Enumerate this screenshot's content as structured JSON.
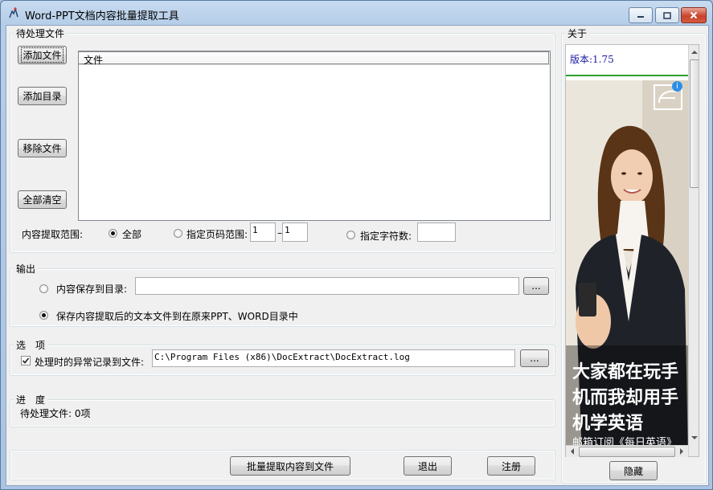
{
  "window": {
    "title": "Word-PPT文档内容批量提取工具"
  },
  "files_group": {
    "legend": "待处理文件",
    "buttons": {
      "add_file": "添加文件",
      "add_dir": "添加目录",
      "remove_file": "移除文件",
      "clear_all": "全部清空"
    },
    "list_header": "文件",
    "range_label": "内容提取范围:",
    "radio_all": "全部",
    "radio_pages": "指定页码范围:",
    "page_from": "1",
    "page_to": "1",
    "radio_chars": "指定字符数:",
    "chars_value": ""
  },
  "output_group": {
    "legend": "输出",
    "save_to_dir_label": "内容保存到目录:",
    "save_to_dir_value": "",
    "browse": "...",
    "save_in_place_label": "保存内容提取后的文本文件到在原来PPT、WORD目录中"
  },
  "options_group": {
    "legend": "选　项",
    "log_label": "处理时的异常记录到文件:",
    "log_path": "C:\\Program Files (x86)\\DocExtract\\DocExtract.log",
    "browse": "..."
  },
  "progress_group": {
    "legend": "进　度",
    "pending": "待处理文件: 0项"
  },
  "bottom_buttons": {
    "extract": "批量提取内容到文件",
    "exit": "退出",
    "register": "注册"
  },
  "about": {
    "legend": "关于",
    "version_label": "版本:",
    "version_value": "1.75",
    "ad_line1": "大家都在玩手",
    "ad_line2": "机而我却用手",
    "ad_line3": "机学英语",
    "ad_subline": "邮箱订阅《每日英语》",
    "ad_info_icon": "i",
    "hide_button": "隐藏"
  },
  "colors": {
    "version_text": "#1a1aa6",
    "version_rule": "#2e9e2e",
    "close_button": "#c8432b"
  }
}
